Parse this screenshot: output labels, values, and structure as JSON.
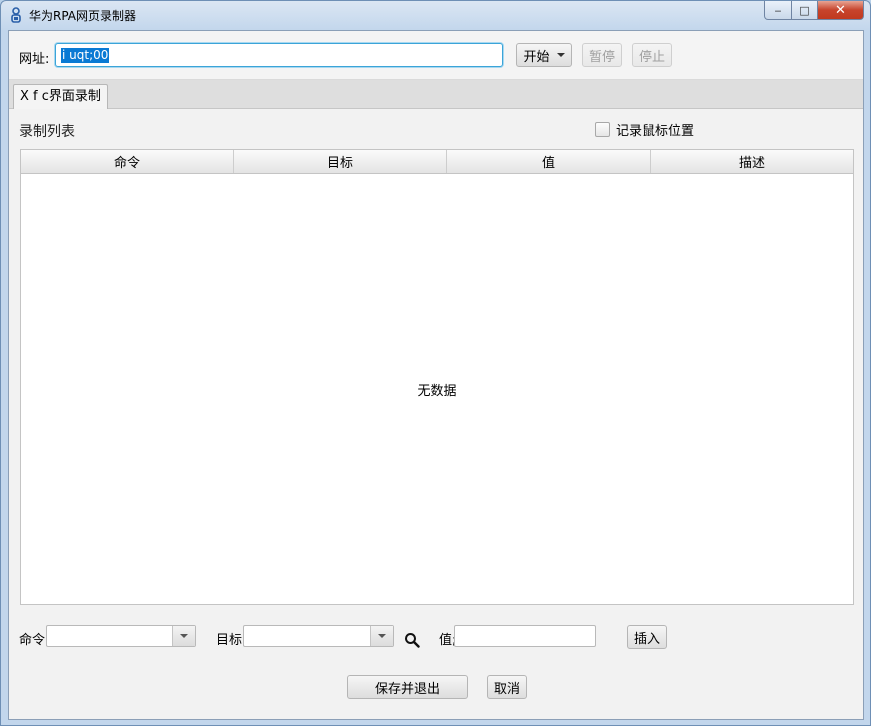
{
  "window": {
    "title": "华为RPA网页录制器",
    "controls": {
      "minimize": "‒",
      "maximize": "□",
      "close": "✕"
    }
  },
  "toolbar": {
    "url_label": "网址:",
    "url_value": "i uqt;00",
    "start_label": "开始",
    "pause_label": "暂停",
    "stop_label": "停止"
  },
  "tabs": [
    {
      "label": "X f c界面录制",
      "active": true
    }
  ],
  "recording": {
    "title": "录制列表",
    "record_mouse_label": "记录鼠标位置",
    "record_mouse_checked": false,
    "columns": [
      "命令",
      "目标",
      "值",
      "描述"
    ],
    "rows": [],
    "empty_text": "无数据"
  },
  "editor": {
    "command_label": "命令;",
    "command_value": "",
    "target_label": "目标;",
    "target_value": "",
    "value_label": "值;",
    "value_value": "",
    "insert_label": "插入"
  },
  "footer": {
    "save_exit_label": "保存并退出",
    "cancel_label": "取消"
  },
  "icons": {
    "app": "rpa-robot-icon",
    "search": "magnifier-icon",
    "dropdown": "chevron-down-icon"
  },
  "colors": {
    "titlebar": "#c2d6ec",
    "focus_border": "#3ba4d8",
    "selection": "#0a7ad4",
    "close_button": "#c7442c"
  }
}
